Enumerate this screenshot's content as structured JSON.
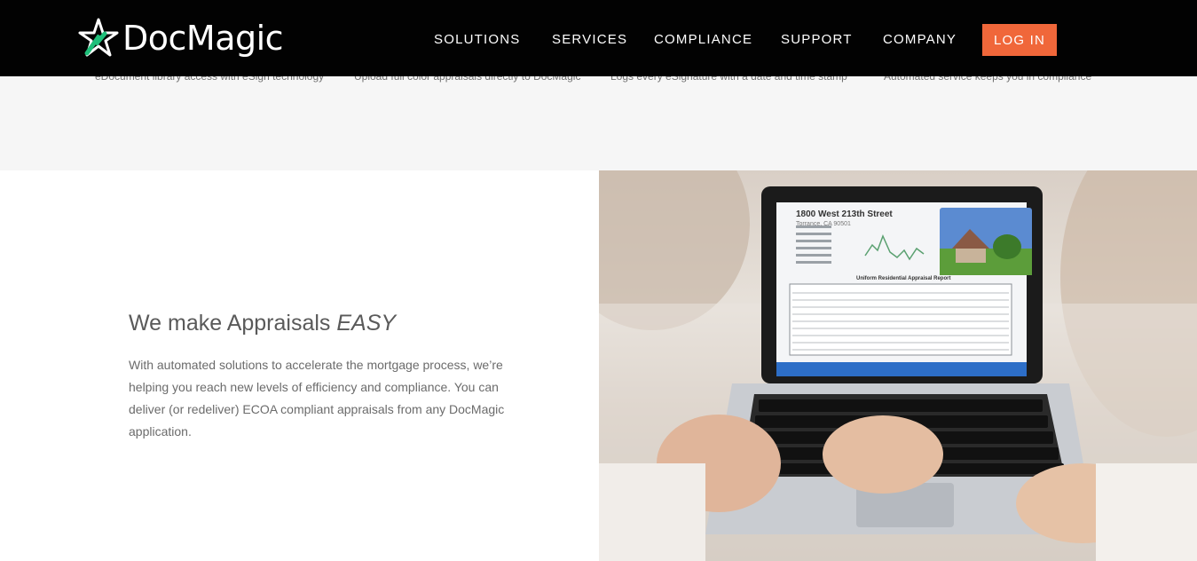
{
  "header": {
    "brand": "DocMagic",
    "nav": [
      "SOLUTIONS",
      "SERVICES",
      "COMPLIANCE",
      "SUPPORT",
      "COMPANY"
    ],
    "login_label": "LOG IN"
  },
  "features": [
    "eDocument library access with eSign technology",
    "Upload full color appraisals directly to DocMagic",
    "Logs every eSignature with a date and time stamp",
    "Automated service keeps you in compliance"
  ],
  "main": {
    "headline_prefix": "We make Appraisals ",
    "headline_emphasis": "EASY",
    "body": "With automated solutions to accelerate the mortgage process, we’re helping you reach new levels of efficiency and compliance. You can deliver (or redeliver) ECOA compliant appraisals from any DocMagic application."
  },
  "screen": {
    "address": "1800 West 213th Street",
    "city": "Torrance, CA 90501",
    "report_title": "Uniform Residential Appraisal Report"
  },
  "colors": {
    "header_bg": "#020202",
    "accent": "#f0673a",
    "logo_star": "#1fbf7a",
    "strip_bg": "#f6f6f6"
  }
}
